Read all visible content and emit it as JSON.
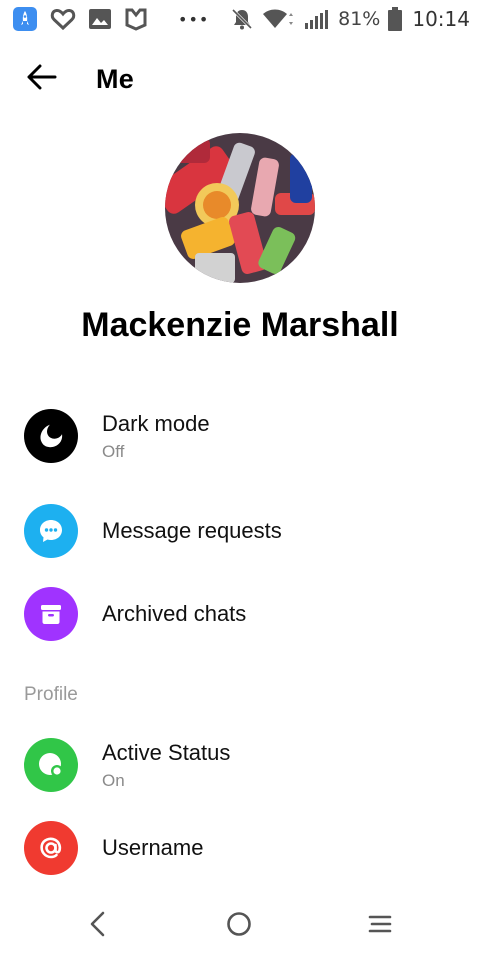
{
  "status_bar": {
    "battery": "81%",
    "time": "10:14",
    "more": "•••",
    "icons": [
      "rocket-app-icon",
      "heart-icon",
      "image-icon",
      "shield-m-icon",
      "more-dots-icon",
      "bell-off-icon",
      "wifi-icon",
      "signal-icon",
      "battery-icon"
    ]
  },
  "app_bar": {
    "title": "Me",
    "back_icon": "arrow-left-icon"
  },
  "profile": {
    "name": "Mackenzie Marshall"
  },
  "items": [
    {
      "title": "Dark mode",
      "subtitle": "Off",
      "icon": "moon-icon",
      "color": "#000000"
    },
    {
      "title": "Message requests",
      "subtitle": "",
      "icon": "chat-bubble-icon",
      "color": "#1DB0F0"
    },
    {
      "title": "Archived chats",
      "subtitle": "",
      "icon": "archive-box-icon",
      "color": "#A033FF"
    }
  ],
  "section": {
    "label": "Profile"
  },
  "profile_items": [
    {
      "title": "Active Status",
      "subtitle": "On",
      "icon": "active-status-icon",
      "color": "#31C648"
    },
    {
      "title": "Username",
      "subtitle": "",
      "icon": "at-sign-icon",
      "color": "#F03A30"
    }
  ],
  "nav": {
    "icons": [
      "nav-back-icon",
      "nav-home-icon",
      "nav-menu-icon"
    ]
  }
}
